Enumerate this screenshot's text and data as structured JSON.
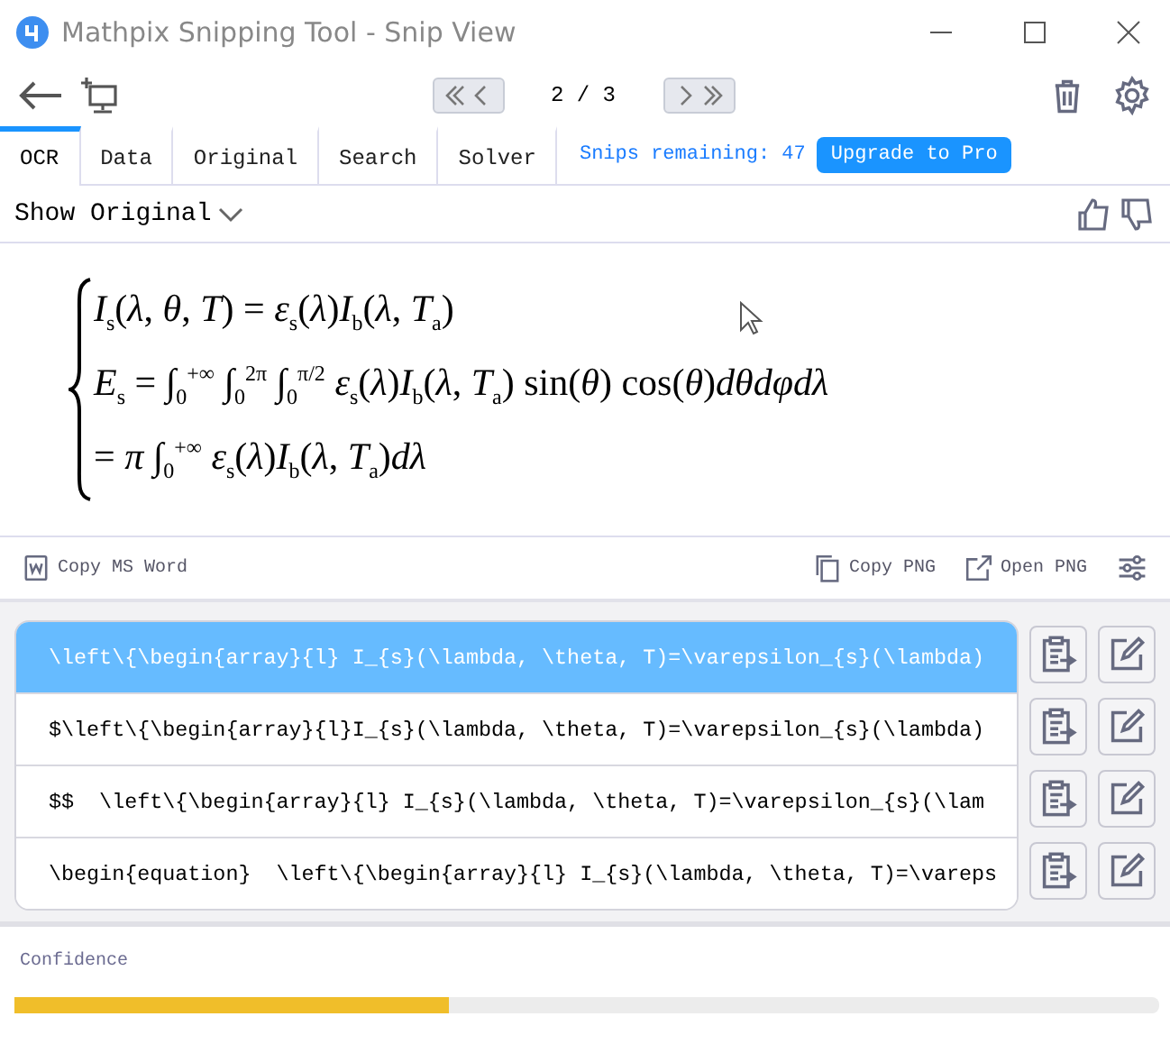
{
  "window": {
    "title": "Mathpix Snipping Tool - Snip View"
  },
  "pager": {
    "text": "2 / 3"
  },
  "tabs": [
    {
      "label": "OCR",
      "selected": true
    },
    {
      "label": "Data",
      "selected": false
    },
    {
      "label": "Original",
      "selected": false
    },
    {
      "label": "Search",
      "selected": false
    },
    {
      "label": "Solver",
      "selected": false
    }
  ],
  "snips_remaining": "Snips remaining: 47",
  "upgrade_button": "Upgrade to Pro",
  "show_original": {
    "label": "Show Original",
    "expanded": false
  },
  "math_lines": [
    "*I*$_{s}$(*λ*, *θ*, *T*) = *ε*$_{s}$(*λ*)*I*$_{b}$(*λ*, *T*$_{a}$)",
    "*E*$_{s}$ = ∫$_{0}$$^{+∞}$ ∫$_{0}$$^{2π}$ ∫$_{0}$$^{π/2}$ *ε*$_{s}$(*λ*)*I*$_{b}$(*λ*, *T*$_{a}$) sin(*θ*) cos(*θ*)*dθdφdλ*",
    "= *π* ∫$_{0}$$^{+∞}$ *ε*$_{s}$(*λ*)*I*$_{b}$(*λ*, *T*$_{a}$)*dλ*"
  ],
  "actions": {
    "copy_word": "Copy MS Word",
    "copy_png": "Copy PNG",
    "open_png": "Open PNG"
  },
  "results": [
    {
      "text": "\\left\\{\\begin{array}{l} I_{s}(\\lambda, \\theta, T)=\\varepsilon_{s}(\\lambda)",
      "selected": true
    },
    {
      "text": "$\\left\\{\\begin{array}{l}I_{s}(\\lambda, \\theta, T)=\\varepsilon_{s}(\\lambda)",
      "selected": false
    },
    {
      "text": "$$  \\left\\{\\begin{array}{l} I_{s}(\\lambda, \\theta, T)=\\varepsilon_{s}(\\lam",
      "selected": false
    },
    {
      "text": "\\begin{equation}  \\left\\{\\begin{array}{l} I_{s}(\\lambda, \\theta, T)=\\vareps",
      "selected": false
    }
  ],
  "confidence": {
    "label": "Confidence",
    "level": 0.38
  }
}
